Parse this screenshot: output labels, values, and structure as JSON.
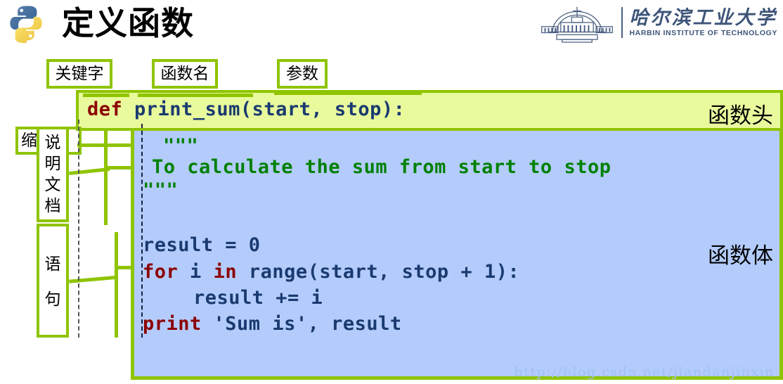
{
  "header": {
    "title": "定义函数",
    "python_logo_alt": "python-logo",
    "university": {
      "chinese_name": "哈尔滨工业大学",
      "english_name": "HARBIN INSTITUTE OF TECHNOLOGY"
    }
  },
  "callouts": {
    "keyword": "关键字",
    "function_name": "函数名",
    "parameters": "参数",
    "indentation": "缩进",
    "docstring": "说\n明\n文\n档",
    "statement": "语\n句"
  },
  "section_labels": {
    "function_head": "函数头",
    "function_body": "函数体"
  },
  "code": {
    "def_keyword": "def",
    "def_signature": " print_sum(start, stop):",
    "doc_open": "\"\"\"",
    "doc_text": "To calculate the sum from start to stop",
    "doc_close": "\"\"\"",
    "result_init": "result = 0",
    "for_keyword": "for",
    "for_mid_var": " i ",
    "in_keyword": "in",
    "for_rest": " range(start, stop + 1):",
    "accumulate": "result += i",
    "print_keyword": "print",
    "print_rest": " 'Sum is', result"
  },
  "watermark": "http://blog.csdn.net/jiandanjinxin",
  "colors": {
    "head_fill": "#e9fa9d",
    "body_fill": "#b3ccfb",
    "accent_green": "#8fc400",
    "keyword_red": "#8c0000",
    "code_navy": "#1a3a70",
    "docstring_green": "#008000",
    "hit_blue": "#3e5579"
  }
}
